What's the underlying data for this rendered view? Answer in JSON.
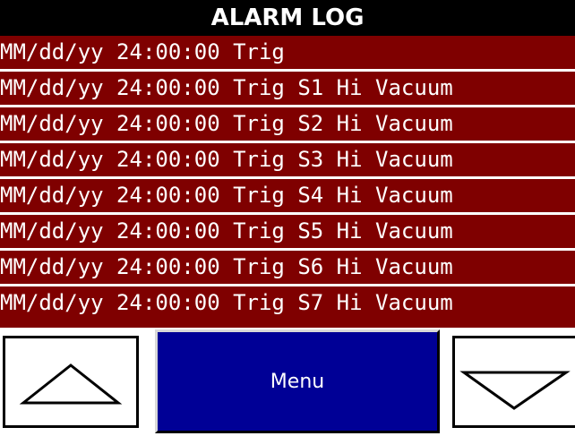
{
  "header": {
    "title": "ALARM LOG"
  },
  "log": {
    "entries": [
      "MM/dd/yy 24:00:00 Trig",
      "MM/dd/yy 24:00:00 Trig S1 Hi Vacuum",
      "MM/dd/yy 24:00:00 Trig S2 Hi Vacuum",
      "MM/dd/yy 24:00:00 Trig S3 Hi Vacuum",
      "MM/dd/yy 24:00:00 Trig S4 Hi Vacuum",
      "MM/dd/yy 24:00:00 Trig S5 Hi Vacuum",
      "MM/dd/yy 24:00:00 Trig S6 Hi Vacuum",
      "MM/dd/yy 24:00:00 Trig S7 Hi Vacuum"
    ]
  },
  "controls": {
    "menu_label": "Menu",
    "up_icon": "triangle-up-icon",
    "down_icon": "triangle-down-icon"
  },
  "colors": {
    "title_bg": "#000000",
    "log_bg": "#800000",
    "menu_bg": "#000096",
    "text": "#ffffff"
  }
}
